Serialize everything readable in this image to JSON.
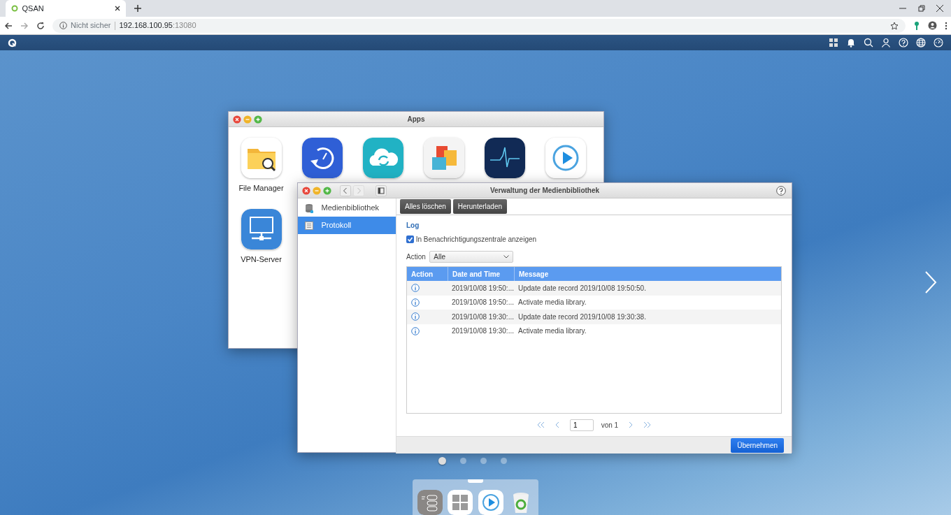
{
  "browser": {
    "tab_title": "QSAN",
    "security": "Nicht sicher",
    "host": "192.168.100.95",
    "port": ":13080"
  },
  "apps_window": {
    "title": "Apps",
    "apps": [
      {
        "kind": "filemanager",
        "label": "File Manager"
      },
      {
        "kind": "backup"
      },
      {
        "kind": "cloud"
      },
      {
        "kind": "blocks"
      },
      {
        "kind": "monitor"
      },
      {
        "kind": "media"
      },
      {
        "kind": "vpn",
        "label": "VPN-Server"
      }
    ]
  },
  "media_window": {
    "title": "Verwaltung der Medienbibliothek",
    "sidebar": [
      {
        "kind": "database",
        "label": "Medienbibliothek",
        "selected": false
      },
      {
        "kind": "log",
        "label": "Protokoll",
        "selected": true
      }
    ],
    "toolbar": [
      "Alles löschen",
      "Herunterladen"
    ],
    "section_title": "Log",
    "notify_checkbox": {
      "label": "In Benachrichtigungszentrale anzeigen",
      "checked": true
    },
    "filter": {
      "label": "Action",
      "value": "Alle"
    },
    "table": {
      "columns": [
        "Action",
        "Date and Time",
        "Message"
      ],
      "rows": [
        {
          "time": "2019/10/08 19:50:...",
          "message": "Update date record 2019/10/08 19:50:50."
        },
        {
          "time": "2019/10/08 19:50:...",
          "message": "Activate media library."
        },
        {
          "time": "2019/10/08 19:30:...",
          "message": "Update date record 2019/10/08 19:30:38."
        },
        {
          "time": "2019/10/08 19:30:...",
          "message": "Activate media library."
        }
      ]
    },
    "pagination": {
      "page": "1",
      "total": "von 1"
    },
    "apply_button": "Übernehmen"
  },
  "page_dots": [
    {
      "selected": true
    },
    {
      "selected": false
    },
    {
      "selected": false
    },
    {
      "selected": false
    }
  ],
  "dock": [
    {
      "kind": "settings"
    },
    {
      "kind": "apps"
    },
    {
      "kind": "media"
    },
    {
      "kind": "trash"
    }
  ]
}
